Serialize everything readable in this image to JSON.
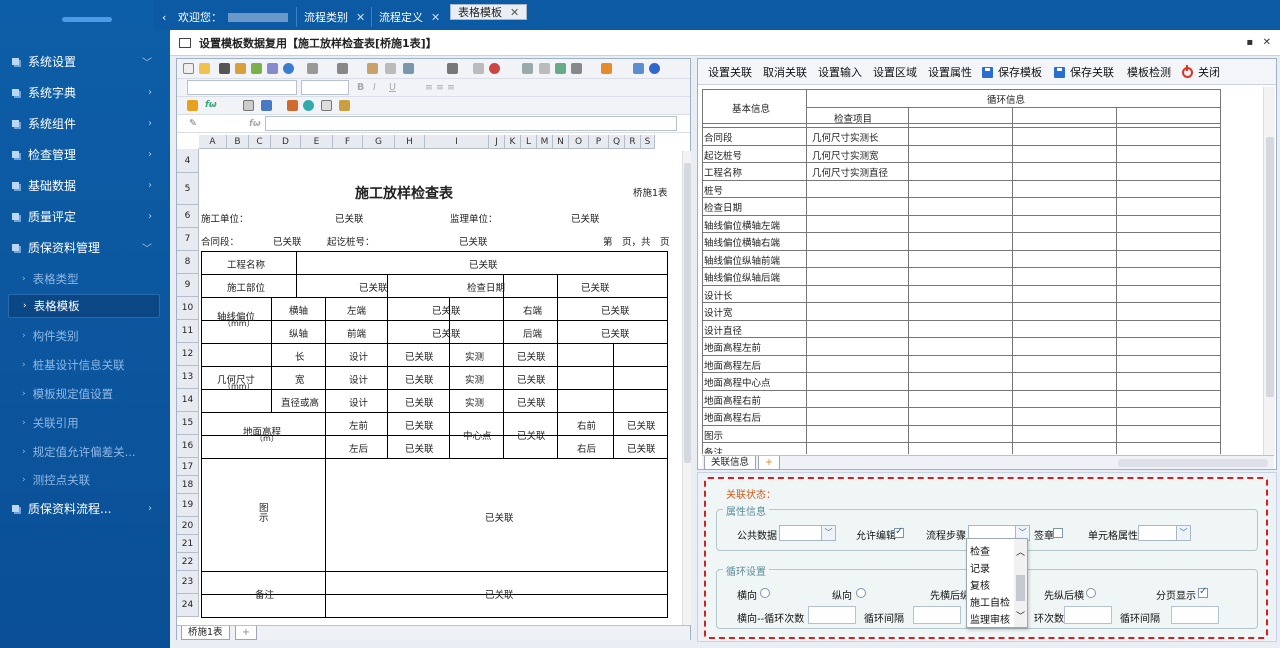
{
  "sidebar": {
    "menu": [
      {
        "label": "系统设置"
      },
      {
        "label": "系统字典"
      },
      {
        "label": "系统组件"
      },
      {
        "label": "检查管理"
      },
      {
        "label": "基础数据"
      },
      {
        "label": "质量评定"
      },
      {
        "label": "质保资料管理"
      }
    ],
    "sub": [
      "表格类型",
      "表格模板",
      "构件类别",
      "桩基设计信息关联",
      "模板规定值设置",
      "关联引用",
      "规定值允许偏差关...",
      "测控点关联"
    ],
    "last": "质保资料流程..."
  },
  "tabs": {
    "welcome": "欢迎您：",
    "items": [
      "流程类别",
      "流程定义",
      "表格模板"
    ]
  },
  "window": {
    "title": "设置模板数据复用【施工放样检查表[桥施1表]】"
  },
  "sheet": {
    "cols": [
      "A",
      "B",
      "C",
      "D",
      "E",
      "F",
      "G",
      "H",
      "I",
      "J",
      "K",
      "L",
      "M",
      "N",
      "O",
      "P",
      "Q",
      "R",
      "S"
    ],
    "rows": [
      "4",
      "5",
      "6",
      "7",
      "8",
      "9",
      "10",
      "11",
      "12",
      "13",
      "14",
      "15",
      "16",
      "17",
      "18",
      "19",
      "20",
      "21",
      "22",
      "23",
      "24"
    ],
    "title": "施工放样检查表",
    "code": "桥施1表",
    "unit": "施工单位：",
    "supervisor": "监理单位：",
    "contract": "合同段：",
    "pile": "起讫桩号：",
    "page": "第　页，共　页",
    "linked": "已关联",
    "proj": "工程名称",
    "part": "施工部位",
    "date": "检查日期",
    "axis": "轴线偏位",
    "mm": "（mm）",
    "m": "（m）",
    "horiz": "横轴",
    "vert": "纵轴",
    "left": "左端",
    "right": "右端",
    "front": "前端",
    "back": "后端",
    "geo": "几何尺寸",
    "len": "长",
    "wid": "宽",
    "dia": "直径或高",
    "design": "设计",
    "actual": "实测",
    "elev": "地面高程",
    "lf": "左前",
    "lb": "左后",
    "center": "中心点",
    "rf": "右前",
    "rbk": "右后",
    "fig": "图",
    "figb": "示",
    "note": "备注",
    "tab1": "桥施1表"
  },
  "right": {
    "buttons": [
      "设置关联",
      "取消关联",
      "设置输入",
      "设置区域",
      "设置属性",
      "保存模板",
      "保存关联",
      "模板检测",
      "关闭"
    ],
    "head1": "基本信息",
    "head2": "循环信息",
    "head3": "检查项目",
    "rows": [
      "合同段",
      "起讫桩号",
      "工程名称",
      "桩号",
      "检查日期",
      "轴线偏位横轴左端",
      "轴线偏位横轴右端",
      "轴线偏位纵轴前端",
      "轴线偏位纵轴后端",
      "设计长",
      "设计宽",
      "设计直径",
      "地面高程左前",
      "地面高程左后",
      "地面高程中心点",
      "地面高程右前",
      "地面高程右后",
      "图示",
      "备注"
    ],
    "items": [
      "几何尺寸实测长",
      "几何尺寸实测宽",
      "几何尺寸实测直径"
    ],
    "tab": "关联信息"
  },
  "bottom": {
    "legend": "关联状态：",
    "attr": "属性信息",
    "public": "公共数据",
    "allow": "允许编辑",
    "step": "流程步骤",
    "sign": "签章",
    "cellattr": "单元格属性",
    "loop": "循环设置",
    "horiz": "横向",
    "vert": "纵向",
    "hv": "先横后纵",
    "vh": "先纵后横",
    "page": "分页显示",
    "hcount": "横向--循环次数",
    "hgap": "循环间隔",
    "vcount": "环次数",
    "vgap": "循环间隔",
    "options": [
      "检查",
      "记录",
      "复核",
      "施工自检",
      "监理审核"
    ]
  }
}
